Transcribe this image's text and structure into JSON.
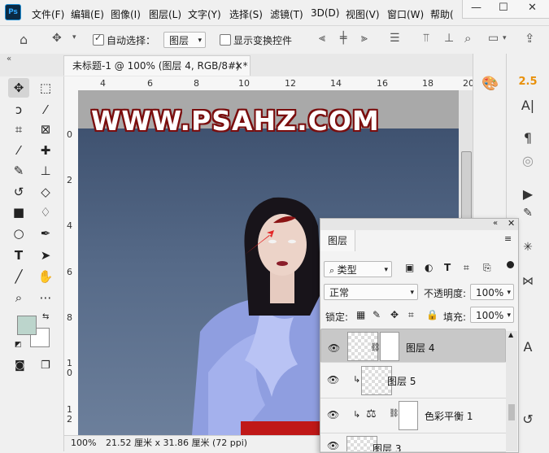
{
  "app": {
    "logo": "Ps"
  },
  "menu": [
    "文件(F)",
    "编辑(E)",
    "图像(I)",
    "图层(L)",
    "文字(Y)",
    "选择(S)",
    "滤镜(T)",
    "3D(D)",
    "视图(V)",
    "窗口(W)",
    "帮助("
  ],
  "window_controls": {
    "minimize": "—",
    "maximize": "☐",
    "close": "✕"
  },
  "options": {
    "auto_select_label": "自动选择：",
    "auto_select_checked": true,
    "auto_select_target": "图层",
    "show_transform_label": "显示变换控件",
    "show_transform_checked": false
  },
  "document_tab": {
    "title": "未标题-1 @ 100% (图层 4, RGB/8#) *",
    "close": "×"
  },
  "rulers": {
    "top_ticks": [
      "4",
      "6",
      "8",
      "10",
      "12",
      "14",
      "16",
      "18",
      "20"
    ],
    "left_ticks": [
      "0",
      "2",
      "4",
      "6",
      "8",
      "1\n0",
      "1\n2"
    ]
  },
  "canvas": {
    "watermark": "WWW.PSAHZ.COM"
  },
  "status": {
    "zoom": "100%",
    "doc_size": "21.52 厘米 x 31.86 厘米 (72 ppi)"
  },
  "dock": {
    "value_badge": "2.5"
  },
  "layers_panel": {
    "tab": "图层",
    "filter_kind": "类型",
    "blend_mode": "正常",
    "opacity_label": "不透明度:",
    "opacity": "100%",
    "lock_label": "锁定:",
    "fill_label": "填充:",
    "fill": "100%",
    "layers": [
      {
        "name": "图层",
        "suffix": "4",
        "selected": true
      },
      {
        "name": "图层",
        "suffix": "5",
        "selected": false
      },
      {
        "name": "色彩平衡",
        "suffix": "1",
        "selected": false
      },
      {
        "name": "图层",
        "suffix": "3",
        "selected": false
      }
    ]
  },
  "colors": {
    "foreground": "#bcd5cc",
    "background": "#ffffff",
    "accent_badge": "#e8900a",
    "watermark_outline": "#7a0d0d"
  }
}
